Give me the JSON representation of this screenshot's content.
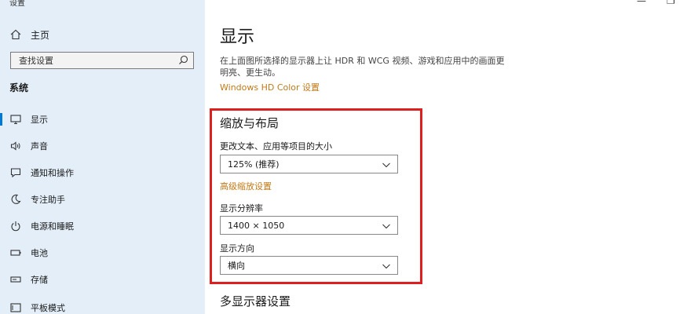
{
  "window": {
    "title": "设置"
  },
  "sidebar": {
    "home_label": "主页",
    "search_placeholder": "查找设置",
    "section_label": "系统",
    "items": [
      {
        "label": "显示",
        "icon": "monitor-icon",
        "active": true
      },
      {
        "label": "声音",
        "icon": "speaker-icon"
      },
      {
        "label": "通知和操作",
        "icon": "notification-icon"
      },
      {
        "label": "专注助手",
        "icon": "moon-icon"
      },
      {
        "label": "电源和睡眠",
        "icon": "power-icon"
      },
      {
        "label": "电池",
        "icon": "battery-icon"
      },
      {
        "label": "存储",
        "icon": "storage-icon"
      },
      {
        "label": "平板模式",
        "icon": "tablet-icon"
      }
    ]
  },
  "main": {
    "title": "显示",
    "description": "在上面图所选择的显示器上让 HDR 和 WCG 视频、游戏和应用中的画面更明亮、更生动。",
    "hd_color_link": "Windows HD Color 设置",
    "scale_group": {
      "title": "缩放与布局",
      "scale_label": "更改文本、应用等项目的大小",
      "scale_value": "125% (推荐)",
      "advanced_link": "高级缩放设置",
      "resolution_label": "显示分辨率",
      "resolution_value": "1400 × 1050",
      "orientation_label": "显示方向",
      "orientation_value": "横向"
    },
    "multi_display_title": "多显示器设置"
  },
  "colors": {
    "highlight": "#dd1f1f",
    "link": "#c27a16",
    "sidebar_bg": "#e3eef8",
    "accent": "#0078d7"
  }
}
